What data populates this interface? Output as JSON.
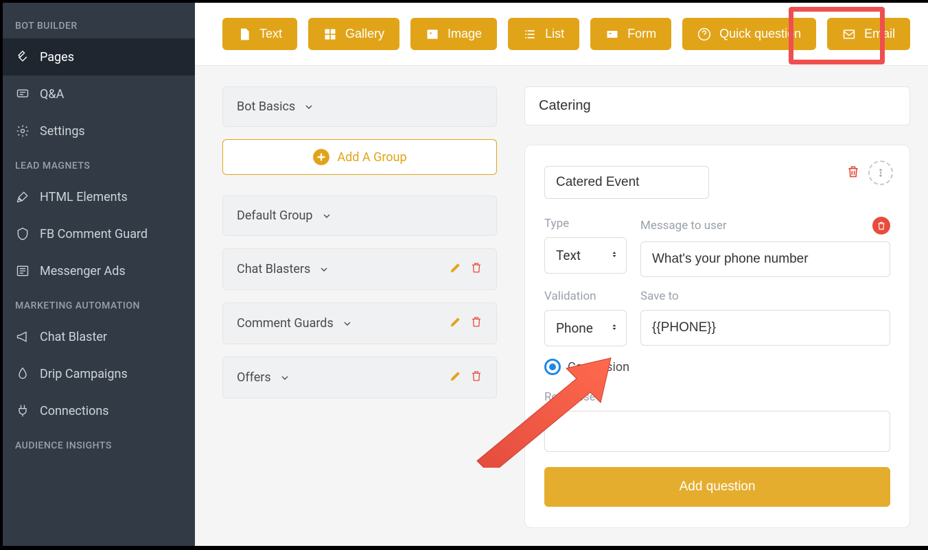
{
  "sidebar": {
    "sections": {
      "builder": "BOT BUILDER",
      "magnets": "LEAD MAGNETS",
      "automation": "MARKETING AUTOMATION",
      "insights": "AUDIENCE INSIGHTS"
    },
    "items": {
      "pages": "Pages",
      "qa": "Q&A",
      "settings": "Settings",
      "html": "HTML Elements",
      "guard": "FB Comment Guard",
      "ads": "Messenger Ads",
      "blaster": "Chat Blaster",
      "drip": "Drip Campaigns",
      "connections": "Connections"
    }
  },
  "toolbar": {
    "text": "Text",
    "gallery": "Gallery",
    "image": "Image",
    "list": "List",
    "form": "Form",
    "quick": "Quick question",
    "email": "Email"
  },
  "groups": {
    "bot_basics": "Bot Basics",
    "add_group": "Add A Group",
    "default": "Default Group",
    "chat_blasters": "Chat Blasters",
    "comment_guards": "Comment Guards",
    "offers": "Offers"
  },
  "form_panel": {
    "title": "Catering",
    "card_name": "Catered Event",
    "type_label": "Type",
    "type_value": "Text",
    "message_label": "Message to user",
    "message_value": "What's your phone number",
    "validation_label": "Validation",
    "validation_value": "Phone",
    "save_to_label": "Save to",
    "save_to_value": "{{PHONE}}",
    "conversion_label": "Conversion",
    "response_label": "Response",
    "add_question": "Add question"
  }
}
